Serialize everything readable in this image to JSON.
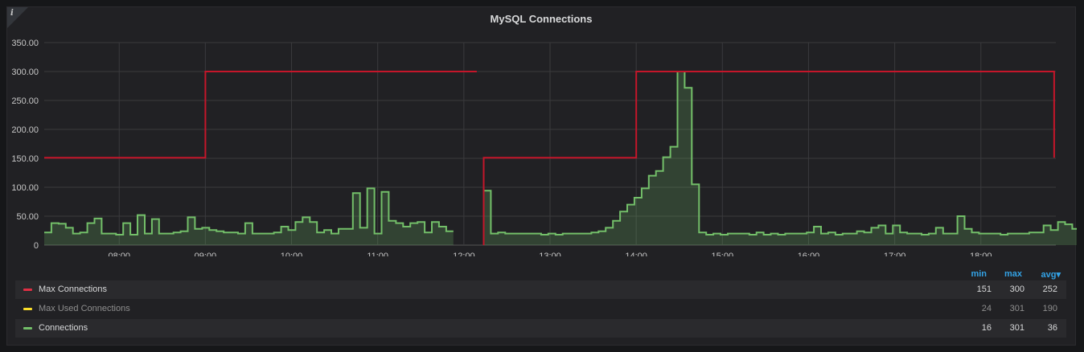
{
  "panel": {
    "title": "MySQL Connections",
    "info_icon": "info-icon"
  },
  "chart_data": {
    "type": "line",
    "title": "MySQL Connections",
    "xlabel": "",
    "ylabel": "",
    "ylim": [
      0,
      350
    ],
    "y_ticks": [
      "350.00",
      "300.00",
      "250.00",
      "200.00",
      "150.00",
      "100.00",
      "50.00",
      "0"
    ],
    "x_ticks": [
      {
        "t": 8,
        "label": "08:00"
      },
      {
        "t": 9,
        "label": "09:00"
      },
      {
        "t": 10,
        "label": "10:00"
      },
      {
        "t": 11,
        "label": "11:00"
      },
      {
        "t": 12,
        "label": "12:00"
      },
      {
        "t": 13,
        "label": "13:00"
      },
      {
        "t": 14,
        "label": "14:00"
      },
      {
        "t": 15,
        "label": "15:00"
      },
      {
        "t": 16,
        "label": "16:00"
      },
      {
        "t": 17,
        "label": "17:00"
      },
      {
        "t": 18,
        "label": "18:00"
      }
    ],
    "xlim": [
      7.13,
      18.87
    ],
    "grid": true,
    "legend_placement": "bottom",
    "series": [
      {
        "name": "Max Connections",
        "color": "#e02f44",
        "stroke": "#c4162a",
        "segments": [
          [
            [
              7.13,
              151
            ],
            [
              9.0,
              151
            ],
            [
              9.0,
              300
            ],
            [
              12.15,
              300
            ]
          ],
          [
            [
              12.23,
              0
            ],
            [
              12.23,
              151
            ],
            [
              14.0,
              151
            ],
            [
              14.0,
              300
            ],
            [
              18.85,
              300
            ],
            [
              18.85,
              151
            ]
          ]
        ]
      },
      {
        "name": "Max Used Connections",
        "color": "#fade2a",
        "hidden": true
      },
      {
        "name": "Connections",
        "color": "#73bf69",
        "stroke": "#73bf69",
        "step": 0.0833,
        "segments": [
          {
            "start": 7.13,
            "values": [
              22,
              38,
              37,
              30,
              20,
              22,
              38,
              46,
              20,
              20,
              18,
              38,
              18,
              52,
              20,
              45,
              20,
              20,
              22,
              24,
              48,
              28,
              30,
              26,
              24,
              22,
              22,
              20,
              38,
              20,
              20,
              20,
              22,
              32,
              26,
              40,
              48,
              40,
              22,
              26,
              20,
              28,
              28,
              90,
              30,
              98,
              20,
              92,
              42,
              38,
              32,
              38,
              40,
              22,
              40,
              32,
              24
            ]
          },
          {
            "start": 12.23,
            "values": [
              94,
              20,
              22,
              20,
              20,
              20,
              20,
              20,
              18,
              20,
              18,
              20,
              20,
              20,
              20,
              22,
              24,
              30,
              42,
              58,
              70,
              82,
              98,
              120,
              128,
              152,
              170,
              300,
              272,
              105,
              22,
              18,
              20,
              18,
              20,
              20,
              20,
              18,
              22,
              18,
              20,
              18,
              20,
              20,
              20,
              22,
              32,
              20,
              22,
              18,
              20,
              20,
              24,
              22,
              30,
              34,
              20,
              34,
              22,
              20,
              20,
              18,
              20,
              30,
              20,
              20,
              50,
              28,
              22,
              20,
              20,
              20,
              18,
              20,
              20,
              20,
              22,
              22,
              34,
              26,
              40,
              36,
              28,
              20,
              46
            ]
          }
        ]
      }
    ]
  },
  "legend": {
    "headers": {
      "min": "min",
      "max": "max",
      "avg": "avg▾"
    },
    "rows": [
      {
        "name": "Max Connections",
        "min": "151",
        "max": "300",
        "avg": "252"
      },
      {
        "name": "Max Used Connections",
        "min": "24",
        "max": "301",
        "avg": "190"
      },
      {
        "name": "Connections",
        "min": "16",
        "max": "301",
        "avg": "36"
      }
    ]
  }
}
